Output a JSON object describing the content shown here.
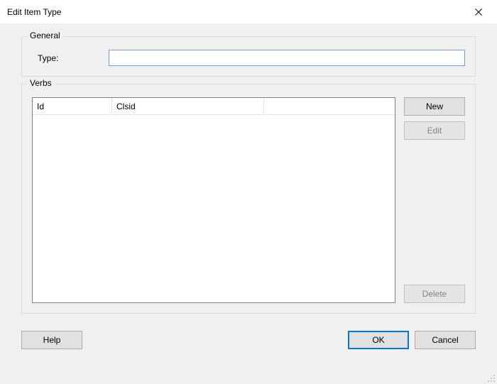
{
  "window": {
    "title": "Edit Item Type"
  },
  "general": {
    "legend": "General",
    "type_label": "Type:",
    "type_value": ""
  },
  "verbs": {
    "legend": "Verbs",
    "columns": {
      "id": "Id",
      "clsid": "Clsid"
    },
    "rows": [],
    "buttons": {
      "new": "New",
      "edit": "Edit",
      "delete": "Delete"
    }
  },
  "footer": {
    "help": "Help",
    "ok": "OK",
    "cancel": "Cancel"
  }
}
